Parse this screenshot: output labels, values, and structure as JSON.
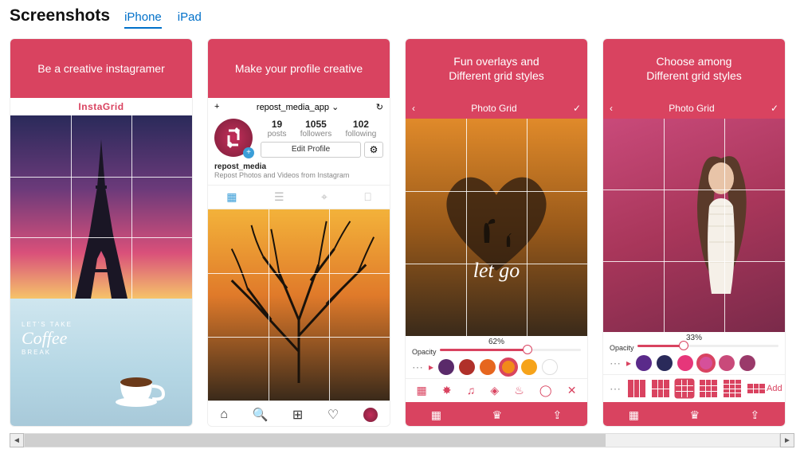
{
  "header": {
    "title": "Screenshots"
  },
  "tabs": [
    {
      "label": "iPhone",
      "active": true
    },
    {
      "label": "iPad",
      "active": false
    }
  ],
  "shots": {
    "s1": {
      "caption": "Be a creative instagramer",
      "app_title": "InstaGrid",
      "coffee_top": "LET'S TAKE",
      "coffee_main": "Coffee",
      "coffee_bottom": "BREAK"
    },
    "s2": {
      "caption": "Make your profile creative",
      "add_icon": "+",
      "username_bar": "repost_media_app",
      "history_icon": "↻",
      "stats": {
        "posts": "19",
        "posts_lbl": "posts",
        "followers": "1055",
        "followers_lbl": "followers",
        "following": "102",
        "following_lbl": "following"
      },
      "edit_btn": "Edit Profile",
      "gear_icon": "⚙",
      "bio_name": "repost_media",
      "bio_desc": "Repost Photos and Videos from Instagram",
      "view_icons": {
        "grid": "▦",
        "list": "☰",
        "tag": "⌖",
        "bookmark": "⎕"
      },
      "tabbar": {
        "home": "⌂",
        "search": "🔍",
        "add": "⊞",
        "like": "♡"
      }
    },
    "s3": {
      "caption": "Fun overlays and\nDifferent grid styles",
      "nav_title": "Photo Grid",
      "back_icon": "‹",
      "done_icon": "✓",
      "overlay_text": "let go",
      "opacity_label": "Opacity",
      "opacity_pct": "62%",
      "swatches": [
        "#5a2a6a",
        "#b0302a",
        "#e6661f",
        "#f28a1a",
        "#f6a31a",
        "#fff"
      ],
      "selected_swatch": 3,
      "stickers": [
        "▦",
        "✸",
        "♫",
        "◈",
        "♨",
        "◯",
        "✕"
      ],
      "bottom": {
        "grid": "▦",
        "crown": "♛",
        "share": "⇪"
      }
    },
    "s4": {
      "caption": "Choose among\nDifferent grid styles",
      "nav_title": "Photo Grid",
      "back_icon": "‹",
      "done_icon": "✓",
      "opacity_label": "Opacity",
      "opacity_pct": "33%",
      "swatches": [
        "#5a2a8a",
        "#2a2a5a",
        "#e6367a",
        "#d6509a",
        "#c94a7a",
        "#9a3a6a"
      ],
      "selected_swatch": 3,
      "grids": [
        "1x3",
        "2x3",
        "3x3",
        "3x3",
        "4x3"
      ],
      "selected_grid": 2,
      "add_label": "Add",
      "bottom": {
        "grid": "▦",
        "crown": "♛",
        "share": "⇪"
      }
    }
  }
}
